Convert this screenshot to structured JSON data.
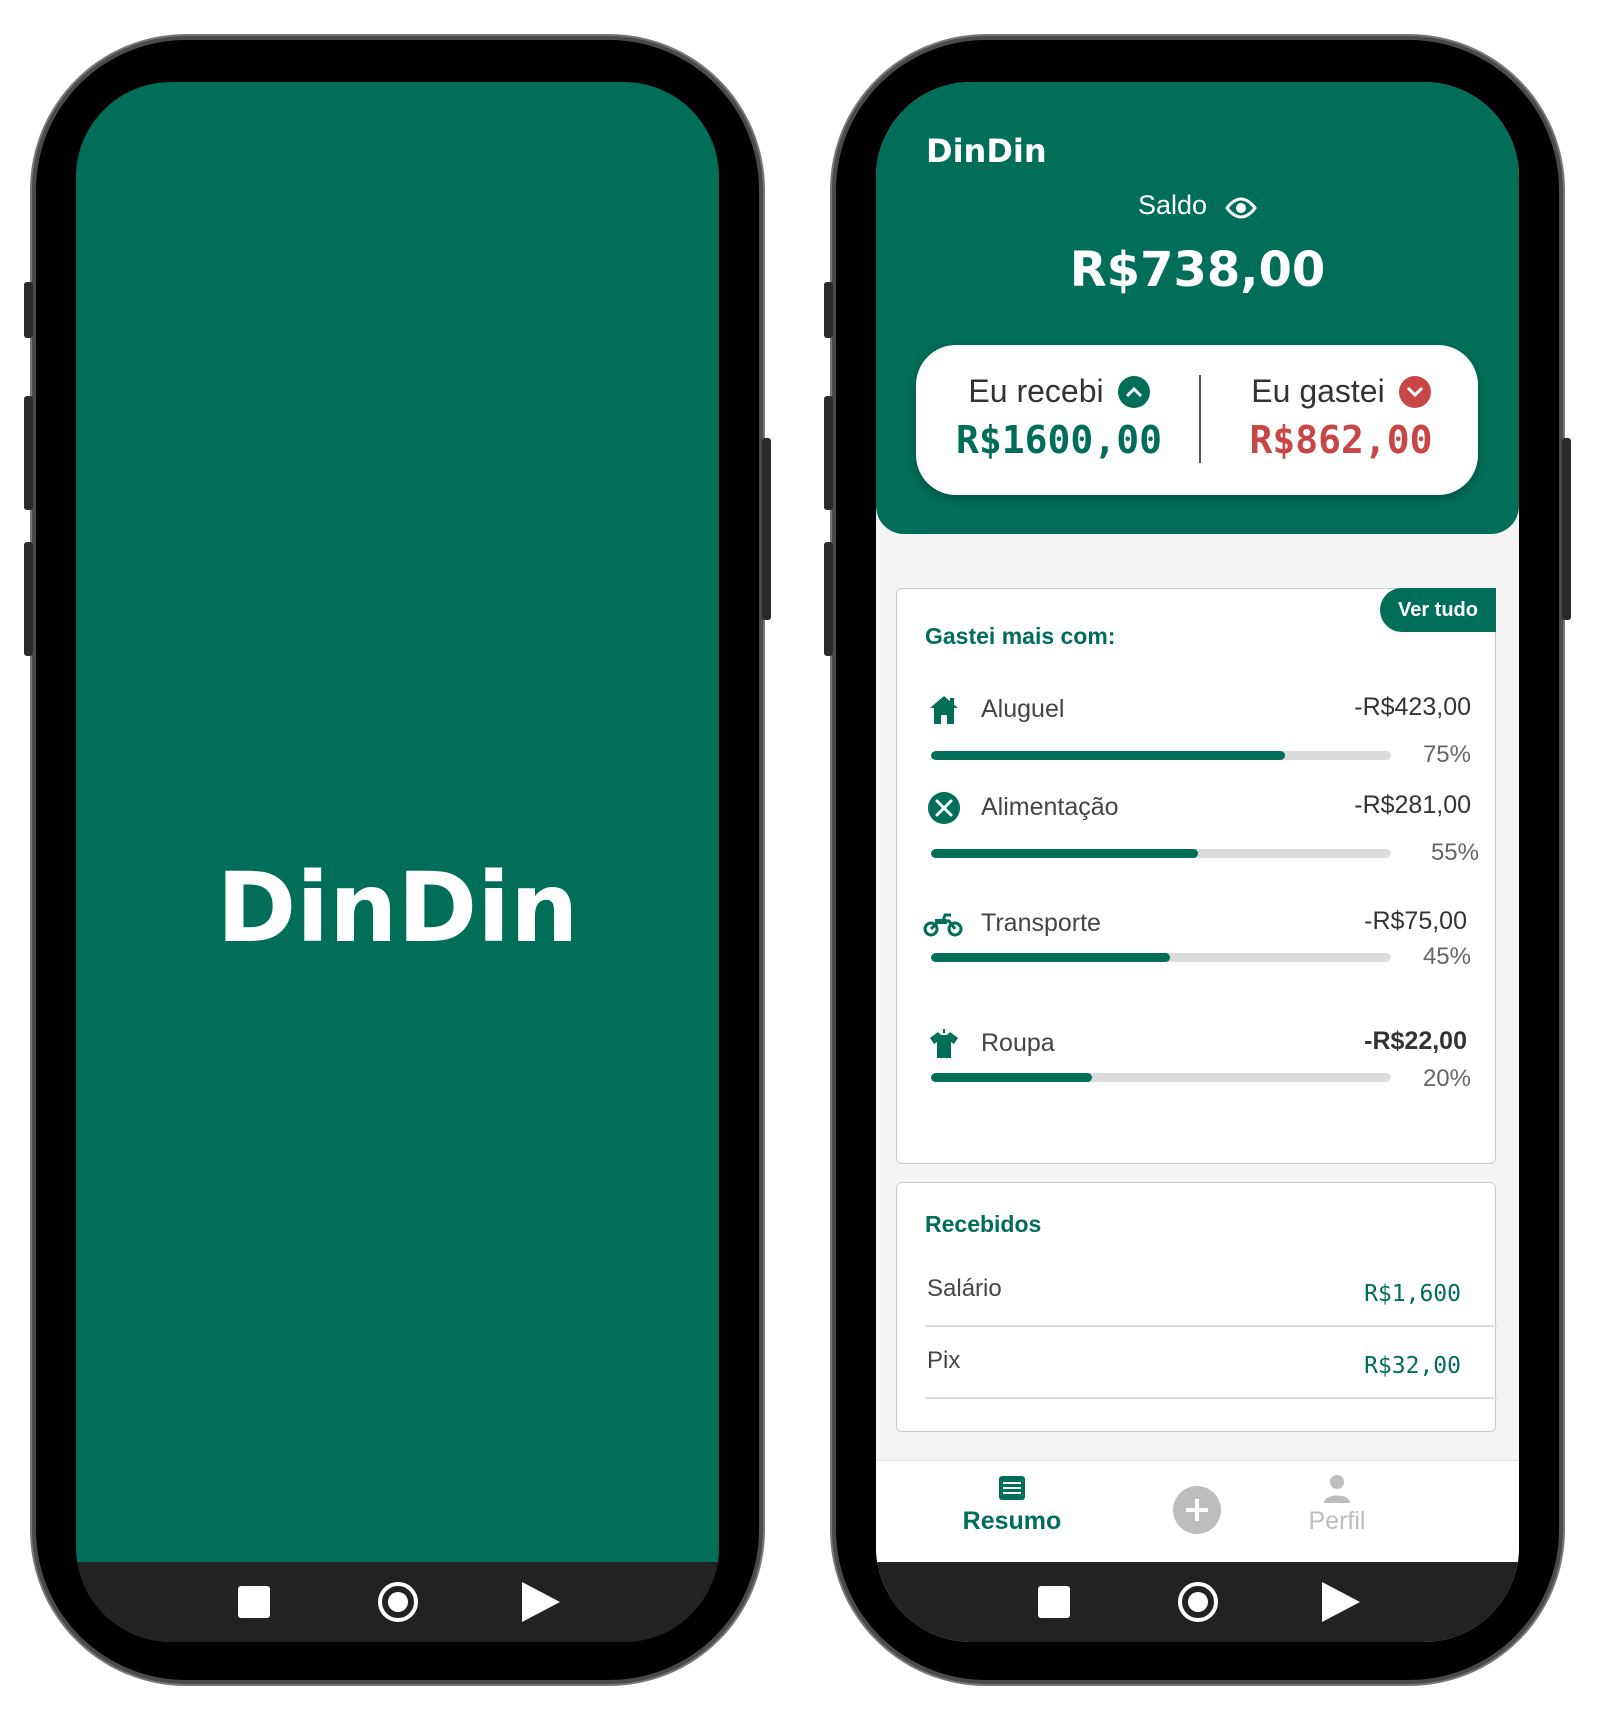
{
  "splash": {
    "title": "DinDin"
  },
  "app": {
    "brand": "DinDin",
    "balance_label": "Saldo",
    "balance_value": "R$738,00",
    "income_label": "Eu recebi",
    "income_value": "R$1600,00",
    "expense_label": "Eu gastei",
    "expense_value": "R$862,00"
  },
  "spending": {
    "title": "Gastei mais com:",
    "see_all": "Ver tudo",
    "items": [
      {
        "name": "Aluguel",
        "amount": "-R$423,00",
        "percent_label": "75%",
        "fill": 0.77,
        "icon": "house-icon"
      },
      {
        "name": "Alimentação",
        "amount": "-R$281,00",
        "percent_label": "55%",
        "fill": 0.58,
        "icon": "food-icon"
      },
      {
        "name": "Transporte",
        "amount": "-R$75,00",
        "percent_label": "45%",
        "fill": 0.52,
        "icon": "motorcycle-icon"
      },
      {
        "name": "Roupa",
        "amount": "-R$22,00",
        "percent_label": "20%",
        "fill": 0.35,
        "icon": "shirt-icon"
      }
    ]
  },
  "received": {
    "title": "Recebidos",
    "items": [
      {
        "name": "Salário",
        "value": "R$1,600"
      },
      {
        "name": "Pix",
        "value": "R$32,00"
      }
    ]
  },
  "tabs": {
    "summary": "Resumo",
    "profile": "Perfil"
  },
  "colors": {
    "brand": "#016e5a",
    "income": "#016e5a",
    "expense": "#c84646",
    "inactive": "#bdbdbd"
  }
}
